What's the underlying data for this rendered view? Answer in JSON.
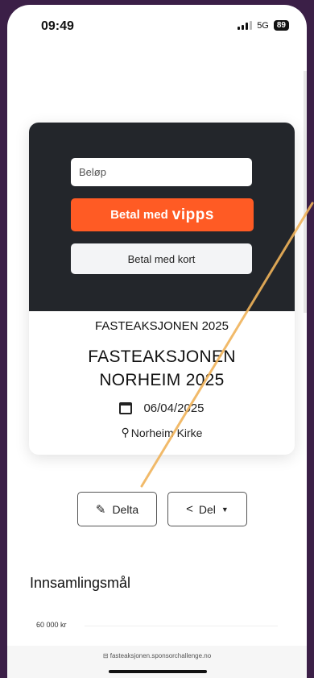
{
  "status_bar": {
    "time": "09:49",
    "network": "5G",
    "battery": "89"
  },
  "donation": {
    "amount_placeholder": "Beløp",
    "vipps_label": "Betal med",
    "vipps_logo": "vipps",
    "card_label": "Betal med kort",
    "vipps_color": "#ff5b24"
  },
  "event": {
    "category": "FASTEAKSJONEN 2025",
    "title": "FASTEAKSJONEN NORHEIM 2025",
    "date": "06/04/2025",
    "location": "Norheim Kirke"
  },
  "actions": {
    "participate_label": "Delta",
    "share_label": "Del"
  },
  "goal": {
    "heading": "Innsamlingsmål",
    "tick_label": "60 000 kr"
  },
  "browser": {
    "url": "fasteaksjonen.sponsorchallenge.no"
  },
  "icons": {
    "calendar": "calendar-icon",
    "location": "location-icon",
    "edit": "edit-icon",
    "share": "share-icon",
    "caret": "caret-down-icon",
    "lock": "lock-icon"
  }
}
